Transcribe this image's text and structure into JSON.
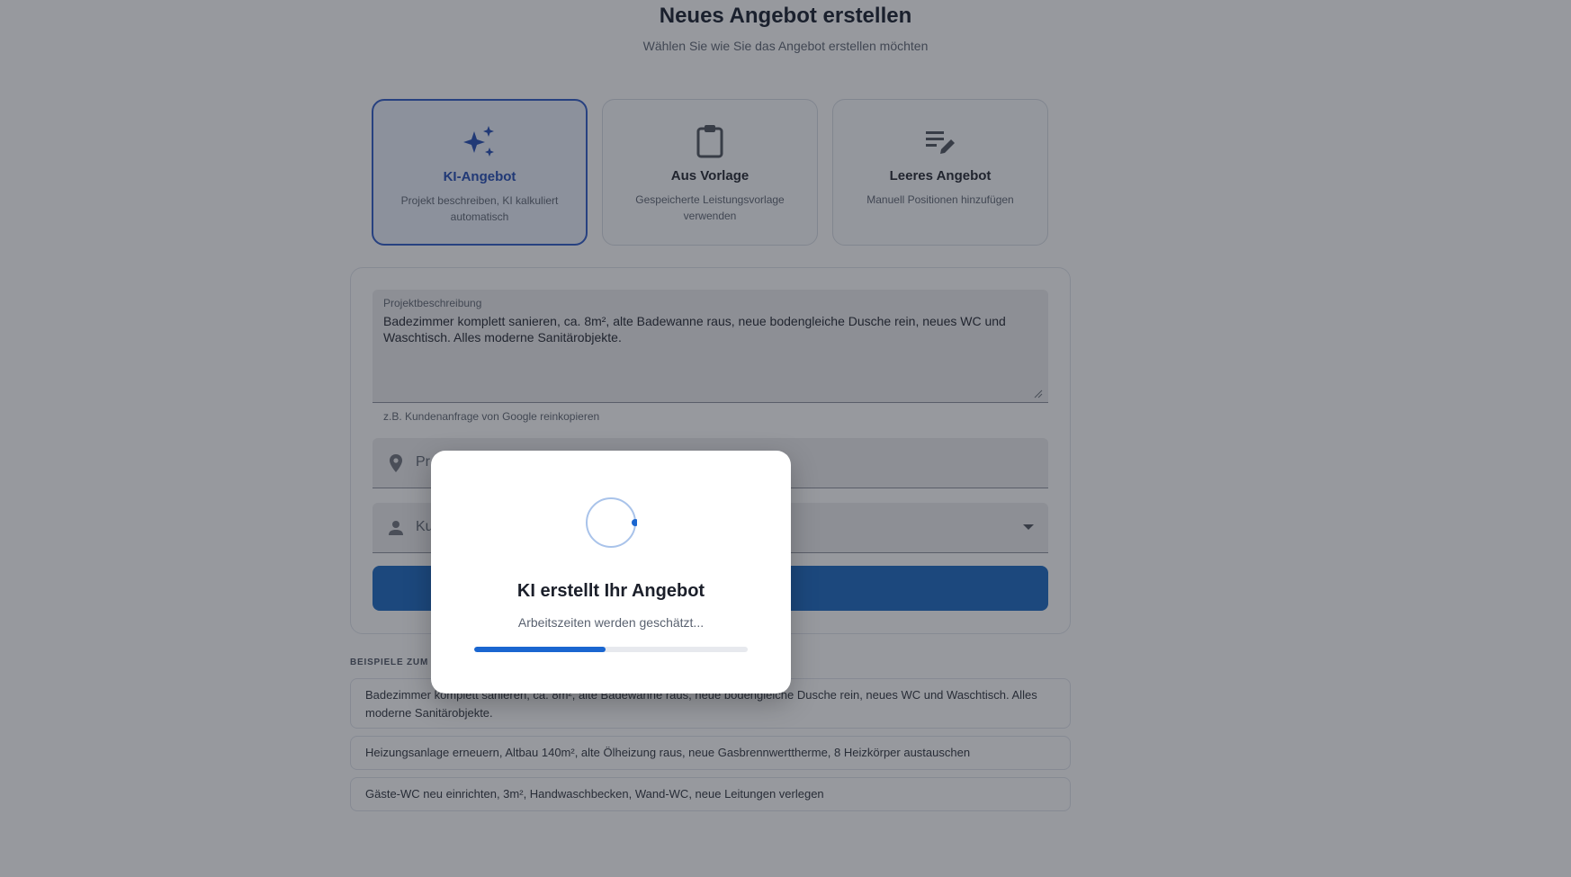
{
  "page": {
    "title": "Neues Angebot erstellen",
    "subtitle": "Wählen Sie wie Sie das Angebot erstellen möchten"
  },
  "modes": [
    {
      "label": "KI-Angebot",
      "description": "Projekt beschreiben, KI kalkuliert automatisch",
      "icon": "sparkles-icon",
      "selected": true
    },
    {
      "label": "Aus Vorlage",
      "description": "Gespeicherte Leistungsvorlage verwenden",
      "icon": "clipboard-icon",
      "selected": false
    },
    {
      "label": "Leeres Angebot",
      "description": "Manuell Positionen hinzufügen",
      "icon": "edit-list-icon",
      "selected": false
    }
  ],
  "form": {
    "description_label": "Projektbeschreibung",
    "description_value": "Badezimmer komplett sanieren, ca. 8m², alte Badewanne raus, neue bodengleiche Dusche rein, neues WC und Waschtisch. Alles moderne Sanitärobjekte.",
    "description_helper": "z.B. Kundenanfrage von Google reinkopieren",
    "location_visible_text": "Pr",
    "customer_visible_text": "Ku"
  },
  "examples": {
    "heading_visible_text": "BEISPIELE ZUM A",
    "items": [
      "Badezimmer komplett sanieren, ca. 8m², alte Badewanne raus, neue bodengleiche Dusche rein, neues WC und Waschtisch. Alles moderne Sanitärobjekte.",
      "Heizungsanlage erneuern, Altbau 140m², alte Ölheizung raus, neue Gasbrennwerttherme, 8 Heizkörper austauschen",
      "Gäste-WC neu einrichten, 3m², Handwaschbecken, Wand-WC, neue Leitungen verlegen"
    ]
  },
  "modal": {
    "title": "KI erstellt Ihr Angebot",
    "status": "Arbeitszeiten werden geschätzt...",
    "progress_fraction": 0.48
  },
  "colors": {
    "primary": "#1565c0",
    "accent": "#2a56c6",
    "overlay": "rgba(38,42,52,0.48)"
  }
}
